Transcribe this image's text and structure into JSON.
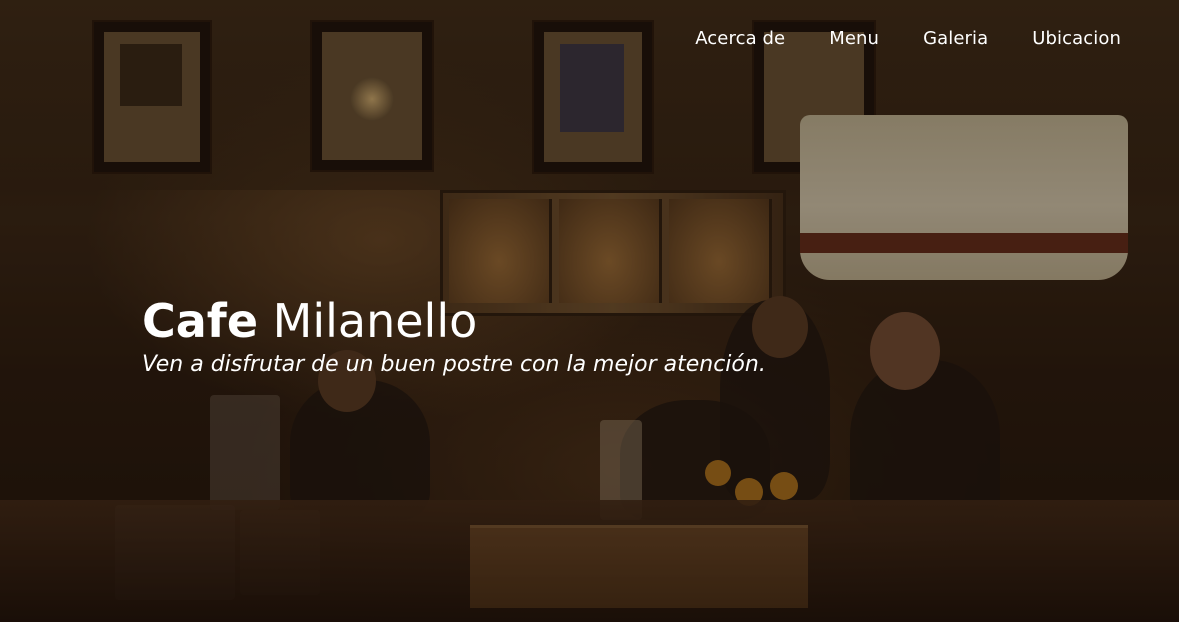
{
  "nav": {
    "items": [
      {
        "label": "Acerca de"
      },
      {
        "label": "Menu"
      },
      {
        "label": "Galeria"
      },
      {
        "label": "Ubicacion"
      }
    ]
  },
  "hero": {
    "title_bold": "Cafe",
    "title_light": "Milanello",
    "subtitle": "Ven a disfrutar de un buen postre con la mejor atención."
  },
  "colors": {
    "text": "#ffffff",
    "overlay": "#140a04"
  }
}
